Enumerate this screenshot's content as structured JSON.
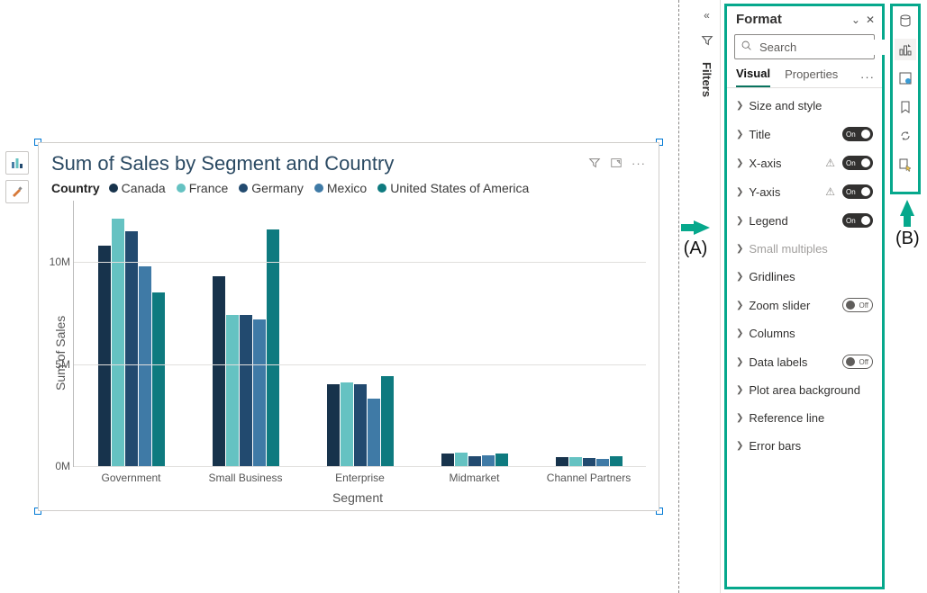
{
  "left_toolbar": {
    "icon1": "chart-icon",
    "icon2": "paint-brush-icon"
  },
  "visual": {
    "title": "Sum of Sales by Segment and Country",
    "legend_title": "Country",
    "icons": {
      "filter": "filter-icon",
      "focus": "focus-mode-icon",
      "more": "more-icon"
    }
  },
  "chart_data": {
    "type": "bar",
    "title": "Sum of Sales by Segment and Country",
    "xlabel": "Segment",
    "ylabel": "Sum of Sales",
    "ylim": [
      0,
      13000000
    ],
    "y_ticks": [
      {
        "v": 0,
        "label": "0M"
      },
      {
        "v": 5000000,
        "label": "5M"
      },
      {
        "v": 10000000,
        "label": "10M"
      }
    ],
    "categories": [
      "Government",
      "Small Business",
      "Enterprise",
      "Midmarket",
      "Channel Partners"
    ],
    "series": [
      {
        "name": "Canada",
        "color": "#17334c",
        "values": [
          10800000,
          9300000,
          4000000,
          600000,
          450000
        ]
      },
      {
        "name": "France",
        "color": "#65c2c2",
        "values": [
          12100000,
          7400000,
          4100000,
          650000,
          450000
        ]
      },
      {
        "name": "Germany",
        "color": "#224a6f",
        "values": [
          11500000,
          7400000,
          4000000,
          500000,
          400000
        ]
      },
      {
        "name": "Mexico",
        "color": "#3f7aa6",
        "values": [
          9800000,
          7200000,
          3300000,
          550000,
          350000
        ]
      },
      {
        "name": "United States of America",
        "color": "#0e7a7f",
        "values": [
          8500000,
          11600000,
          4400000,
          600000,
          500000
        ]
      }
    ]
  },
  "filters_strip": {
    "label": "Filters"
  },
  "format_pane": {
    "title": "Format",
    "search_placeholder": "Search",
    "tabs": {
      "visual": "Visual",
      "properties": "Properties"
    },
    "rows": [
      {
        "label": "Size and style",
        "toggle": null
      },
      {
        "label": "Title",
        "toggle": "on"
      },
      {
        "label": "X-axis",
        "toggle": "on",
        "warn": true
      },
      {
        "label": "Y-axis",
        "toggle": "on",
        "warn": true
      },
      {
        "label": "Legend",
        "toggle": "on"
      },
      {
        "label": "Small multiples",
        "toggle": null,
        "disabled": true
      },
      {
        "label": "Gridlines",
        "toggle": null
      },
      {
        "label": "Zoom slider",
        "toggle": "off"
      },
      {
        "label": "Columns",
        "toggle": null
      },
      {
        "label": "Data labels",
        "toggle": "off"
      },
      {
        "label": "Plot area background",
        "toggle": null
      },
      {
        "label": "Reference line",
        "toggle": null
      },
      {
        "label": "Error bars",
        "toggle": null
      }
    ],
    "toggle_on_label": "On",
    "toggle_off_label": "Off"
  },
  "callouts": {
    "a": "(A)",
    "b": "(B)"
  },
  "ribbon_icons": [
    "data-icon",
    "format-icon",
    "drill-icon",
    "bookmark-icon",
    "sync-icon",
    "select-icon"
  ]
}
